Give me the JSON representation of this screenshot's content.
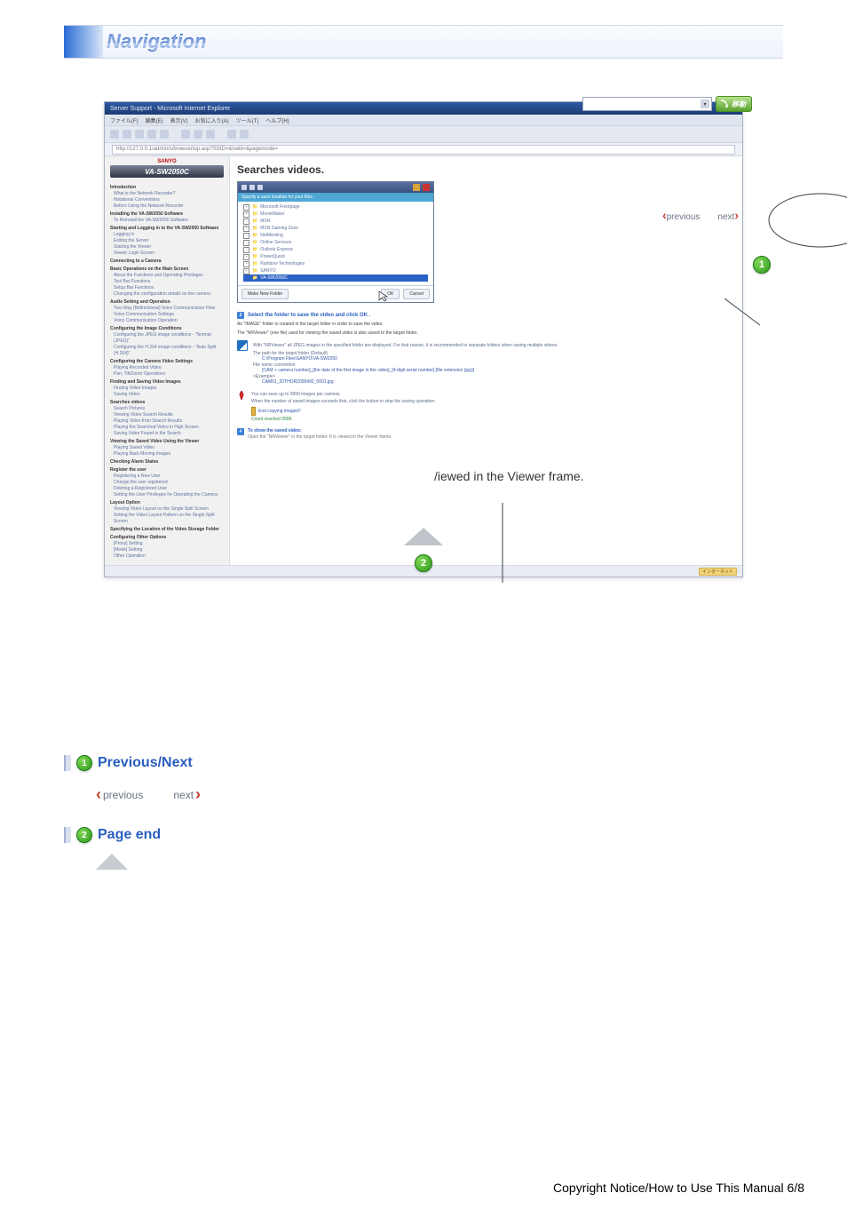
{
  "page_title": "Navigation",
  "browser": {
    "titlebar": "Server Support - Microsoft Internet Explorer",
    "menus": [
      "ファイル(F)",
      "編集(E)",
      "表示(V)",
      "お気に入り(A)",
      "ツール(T)",
      "ヘルプ(H)"
    ],
    "address": "http://127.0.0.1/admin/s/browsertop.asp?SSID=&nwid=&pagemode="
  },
  "go_button": "移動",
  "model_label": "SANYO",
  "model_strip": "VA-SW2050C",
  "main_heading": "Searches videos.",
  "tree_strip": "Specify a save location for your files.",
  "tree": [
    {
      "label": "Microsoft Frontpage",
      "expand": "+"
    },
    {
      "label": "MovieMaker",
      "expand": "+"
    },
    {
      "label": "MSN",
      "expand": "-"
    },
    {
      "label": "MSN Gaming Zone",
      "expand": "+"
    },
    {
      "label": "NetMeeting",
      "expand": "-"
    },
    {
      "label": "Online Services",
      "expand": "-"
    },
    {
      "label": "Outlook Express",
      "expand": "-"
    },
    {
      "label": "PowerQuest",
      "expand": "+"
    },
    {
      "label": "Rainbow Technologies",
      "expand": "+"
    },
    {
      "label": "SANYO",
      "expand": "+"
    },
    {
      "label": "VA-SW2050C",
      "expand": "",
      "selected": true
    }
  ],
  "buttons": {
    "new_folder": "Make New Folder",
    "ok": "OK",
    "cancel": "Cancel"
  },
  "step2": {
    "title": "Select the folder to save the video and click  OK .",
    "line_a": "An \"IMAGE\" folder is created in the target folder in order to save the video.",
    "line_b": "The \"NRViewer\" (exe file) used for viewing the saved video is also saved to the target folder.",
    "note_head": "With \"NRViewer\" all JPEG images in the specified folder are displayed. For that reason, it is recommended to separate folders when saving multiple videos.",
    "blue": {
      "k1": "The path for the target folder (Default)",
      "v1": "C:\\Program Files\\SANYO\\VA-SW2050",
      "k2": "File name convention",
      "v2": "[CAM + camera number]_[the date of the first image in the video]_[4-digit serial number].[file extension (jpg)]",
      "k3": "<Example>",
      "v3": "CAM01_20THOR2000492_0001.jpg"
    }
  },
  "step3": {
    "line1": "You can save up to 9999 images per camera.",
    "line2": "When the number of saved images exceeds that, click the button to stop the saving operation.",
    "stopped": "End copying images!!",
    "count": "Count reached 9999."
  },
  "step4": {
    "title": "To show the saved video:",
    "line": "Open the \"NRViewer\" in the target folder. It is viewed in the Viewer frame."
  },
  "prevnext": {
    "previous": "previous",
    "next": "next"
  },
  "status_bar": {
    "zone": "インターネット"
  },
  "callout_center": "/iewed in the Viewer frame.",
  "badges": {
    "one": "1",
    "two": "2"
  },
  "sections": {
    "s1_title": "Previous/Next",
    "s2_title": "Page end"
  },
  "footer": "Copyright Notice/How to Use This Manual 6/8",
  "sidebar_groups": [
    {
      "title": "Introduction",
      "items": [
        "What is the Network Recorder?",
        "Notational Conventions",
        "Before Using the Network Recorder"
      ]
    },
    {
      "title": "Installing the VA-SW2050 Software",
      "items": [
        "To Reinstall the VA-SW2050 Software"
      ]
    },
    {
      "title": "Starting and Logging in to the VA-SW2050 Software",
      "items": [
        "Logging In",
        "Exiting the Server",
        "Starting the Viewer",
        "Viewer Login Screen"
      ]
    },
    {
      "title": "Connecting to a Camera",
      "items": []
    },
    {
      "title": "Basic Operations on the Main Screen",
      "items": [
        "About the Functions and Operating Privileges",
        "Tool Bar Functions",
        "Setup Bar Functions",
        "Changing the configuration details on the camera"
      ]
    },
    {
      "title": "Audio Setting and Operation",
      "items": [
        "Two-Way (Bidirectional) Voice Communication Flow",
        "Voice Communication Settings",
        "Voice Communication Operation"
      ]
    },
    {
      "title": "Configuring the Image Conditions",
      "items": [
        "Configuring the JPEG image conditions - \"Normal (JPEG)\"",
        "Configuring the H.264 image conditions - \"Auto Split (H.264)\""
      ]
    },
    {
      "title": "Configuring the Camera Video Settings",
      "items": [
        "Playing Recorded Video",
        "Pan, Tilt/Zoom Operations"
      ]
    },
    {
      "title": "Finding and Saving Video Images",
      "items": [
        "Finding Video Images",
        "Saving Video"
      ]
    },
    {
      "title": "Searches videos",
      "items": [
        "Search Pictures",
        "Viewing Video Search Results",
        "Playing Video from Search Results",
        "Playing the Searched Video in High Screen",
        "Saving Video Found in the Search"
      ]
    },
    {
      "title": "Viewing the Saved Video Using the Viewer",
      "items": [
        "Playing Saved Video",
        "Playing Back Moving Images"
      ]
    },
    {
      "title": "Checking Alarm States",
      "items": []
    },
    {
      "title": "Register the user",
      "items": [
        "Registering a New User",
        "Change the user registered",
        "Deleting a Registered User",
        "Setting the User Privileges for Operating the Camera"
      ]
    },
    {
      "title": "Layout Option",
      "items": [
        "Viewing Video Layout on the Single Split Screen",
        "Setting the Video Layout Pattern on the Single Split Screen"
      ]
    },
    {
      "title": "Specifying the Location of the Video Storage Folder",
      "items": []
    },
    {
      "title": "Configuring Other Options",
      "items": [
        "[Proxy] Setting",
        "[Mode] Setting",
        "Other Operation"
      ]
    }
  ]
}
